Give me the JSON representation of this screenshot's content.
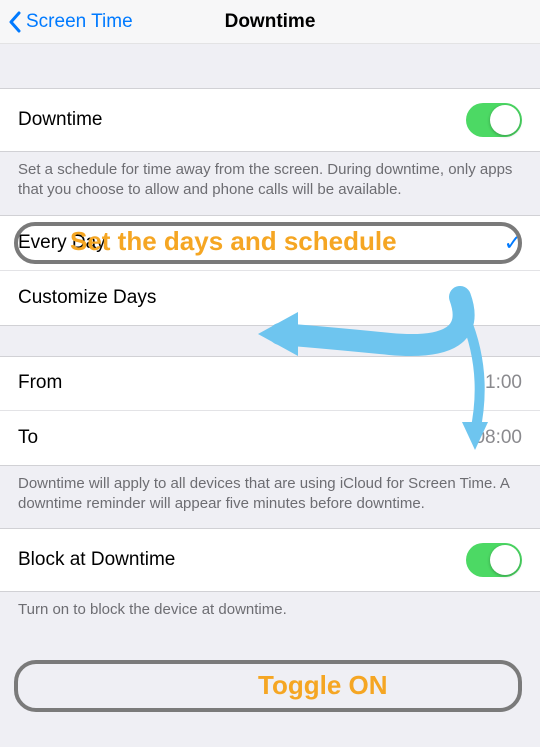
{
  "navbar": {
    "back_label": "Screen Time",
    "title": "Downtime"
  },
  "main_toggle": {
    "label": "Downtime",
    "on": true
  },
  "main_footer": "Set a schedule for time away from the screen. During downtime, only apps that you choose to allow and phone calls will be available.",
  "schedule": {
    "every_day_label": "Every Day",
    "every_day_selected": true,
    "customize_label": "Customize Days"
  },
  "time": {
    "from_label": "From",
    "from_value": "21:00",
    "to_label": "To",
    "to_value": "08:00"
  },
  "time_footer": "Downtime will apply to all devices that are using iCloud for Screen Time. A downtime reminder will appear five minutes before downtime.",
  "block": {
    "label": "Block at Downtime",
    "on": true
  },
  "block_footer": "Turn on to block the device at downtime.",
  "annotations": {
    "schedule_text": "Set the days and schedule",
    "toggle_text": "Toggle ON"
  }
}
